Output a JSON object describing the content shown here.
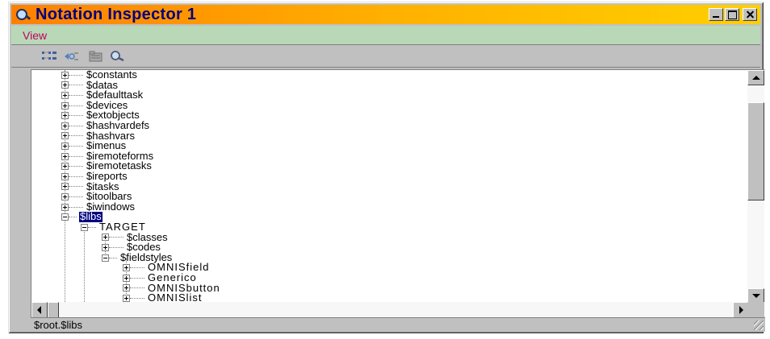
{
  "window": {
    "title": "Notation Inspector 1"
  },
  "menu": {
    "view_label": "View"
  },
  "toolbar": {
    "icons": [
      "tree-expand-icon",
      "connect-icon",
      "folder-icon",
      "search-icon"
    ]
  },
  "tree": {
    "root_items": [
      "$constants",
      "$datas",
      "$defaulttask",
      "$devices",
      "$extobjects",
      "$hashvardefs",
      "$hashvars",
      "$imenus",
      "$iremoteforms",
      "$iremotetasks",
      "$ireports",
      "$itasks",
      "$itoolbars",
      "$iwindows"
    ],
    "selected_item": "$libs",
    "library": "TARGET",
    "library_children": [
      "$classes",
      "$codes",
      "$fieldstyles"
    ],
    "fieldstyles_children": [
      "OMNISfield",
      "Generico",
      "OMNISbutton",
      "OMNISlist"
    ]
  },
  "status": {
    "path": "$root.$libs"
  },
  "colors": {
    "title_gradient_start": "#ff8000",
    "title_gradient_end": "#ffd000",
    "title_text": "#000080",
    "menubar_bg": "#b8d8b8",
    "menu_text": "#c00060",
    "selection_bg": "#000080"
  }
}
